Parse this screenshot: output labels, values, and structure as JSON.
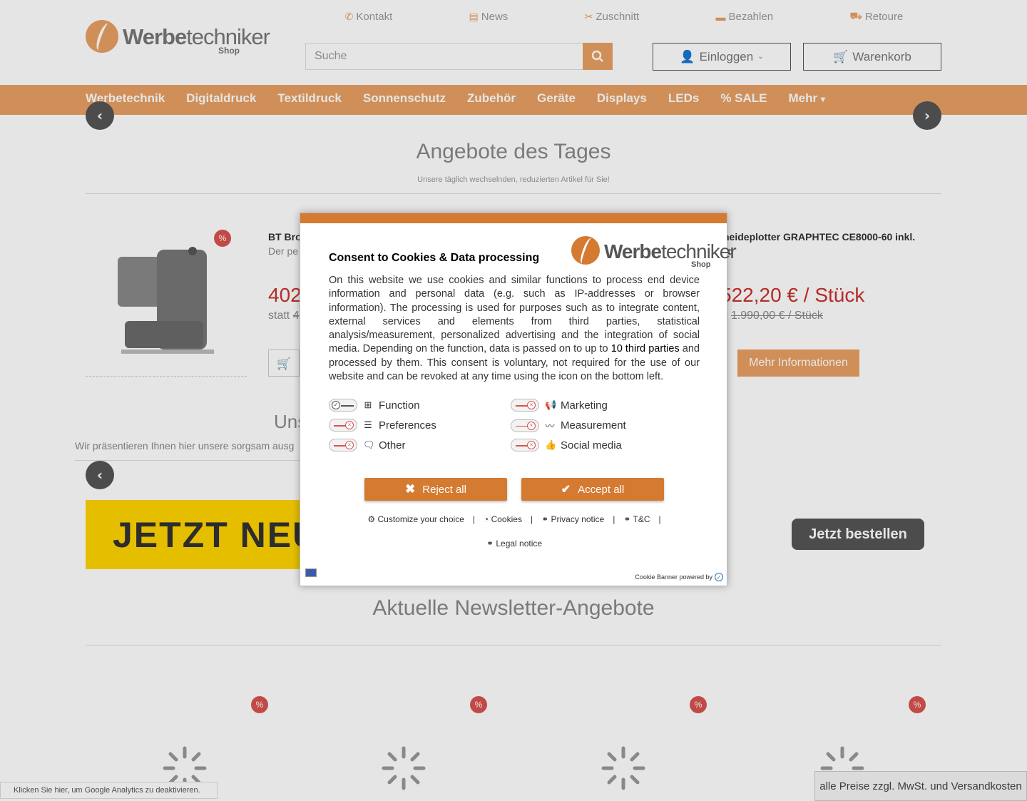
{
  "topnav": [
    {
      "icon": "phone-icon",
      "label": "Kontakt"
    },
    {
      "icon": "newspaper-icon",
      "label": "News"
    },
    {
      "icon": "scissors-icon",
      "label": "Zuschnitt"
    },
    {
      "icon": "credit-card-icon",
      "label": "Bezahlen"
    },
    {
      "icon": "truck-icon",
      "label": "Retoure"
    }
  ],
  "logo": {
    "word_bold": "Werbe",
    "word_light": "techniker",
    "shop": "Shop"
  },
  "search": {
    "placeholder": "Suche"
  },
  "account": {
    "login_label": "Einloggen",
    "cart_label": "Warenkorb"
  },
  "mainnav": [
    "Werbetechnik",
    "Digitaldruck",
    "Textildruck",
    "Sonnenschutz",
    "Zubehör",
    "Geräte",
    "Displays",
    "LEDs",
    "% SALE",
    "Mehr"
  ],
  "deals": {
    "title": "Angebote des Tages",
    "subtitle": "Unsere täglich wechselnden, reduzierten Artikel für Sie!",
    "badge": "%",
    "product1": {
      "name": "BT Bro",
      "sub": "Der pe",
      "price": "402",
      "old_prefix": "statt",
      "old_price": "4"
    },
    "product2": {
      "name": "neideplotter GRAPHTEC CE8000-60 inkl.",
      "sub": "d",
      "price": "522,20 € / Stück",
      "old_prefix": "t",
      "old_price": "1.990,00 € / Stück"
    },
    "more_label": "Mehr Informationen"
  },
  "section2": {
    "title": "Uns",
    "subtitle": "Wir präsentieren Ihnen hier unsere sorgsam ausg"
  },
  "banner": {
    "text": "JETZT NEU",
    "cta": "Jetzt bestellen"
  },
  "newsletter": {
    "title": "Aktuelle Newsletter-Angebote",
    "badge": "%"
  },
  "ga_note": "Klicken Sie hier, um Google Analytics zu deaktivieren.",
  "vat_note": "alle Preise zzgl. MwSt. und Versandkosten",
  "consent": {
    "title": "Consent to Cookies & Data processing",
    "body_before": "On this website we use cookies and similar functions to process end device information and personal data (e.g. such as IP-addresses or browser information). The processing is used for purposes such as to integrate content, external services and elements from third parties, statistical analysis/measurement, personalized advertising and the integration of social media. Depending on the function, data is passed on to up to ",
    "body_link": "10 third parties",
    "body_after": " and processed by them. This consent is voluntary, not required for the use of our website and can be revoked at any time using the icon on the bottom left.",
    "categories": [
      {
        "label": "Function",
        "state": "on",
        "icon": "function-icon"
      },
      {
        "label": "Marketing",
        "state": "off",
        "icon": "megaphone-icon"
      },
      {
        "label": "Preferences",
        "state": "off",
        "icon": "sliders-icon"
      },
      {
        "label": "Measurement",
        "state": "off",
        "icon": "chart-icon"
      },
      {
        "label": "Other",
        "state": "off",
        "icon": "chat-icon"
      },
      {
        "label": "Social media",
        "state": "off",
        "icon": "thumbs-up-icon"
      }
    ],
    "reject_label": "Reject all",
    "accept_label": "Accept all",
    "links": [
      "Customize your choice",
      "Cookies",
      "Privacy notice",
      "T&C",
      "Legal notice"
    ],
    "powered_by": "Cookie Banner powered by",
    "colors": {
      "accent": "#d47a31",
      "brand": "#e8a062"
    }
  }
}
